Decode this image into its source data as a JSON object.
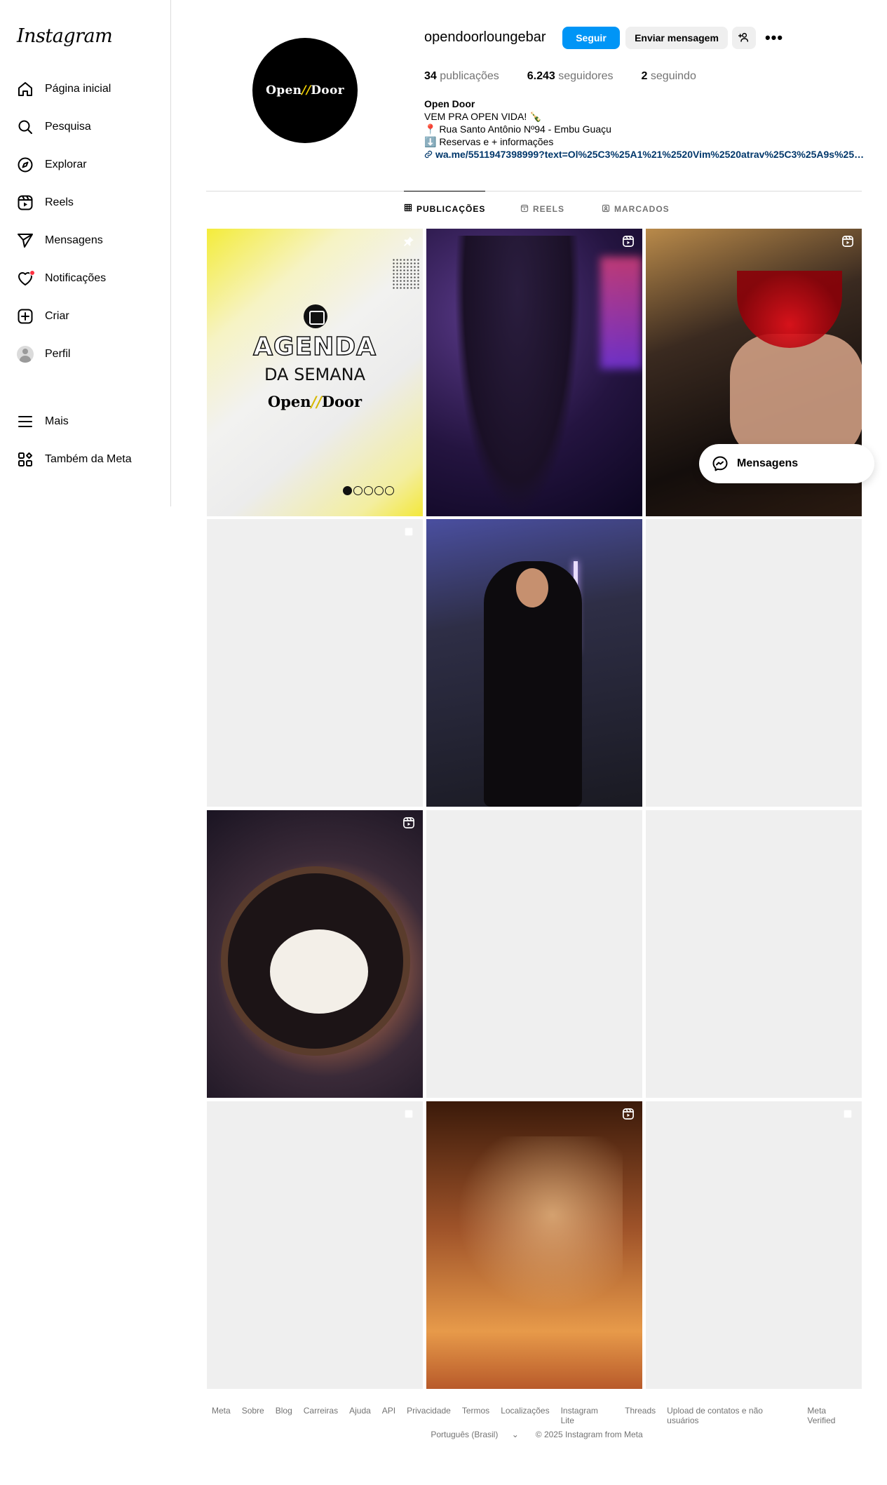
{
  "app": {
    "logo": "Instagram"
  },
  "sidebar": {
    "items": [
      {
        "label": "Página inicial",
        "icon": "home-icon"
      },
      {
        "label": "Pesquisa",
        "icon": "search-icon"
      },
      {
        "label": "Explorar",
        "icon": "compass-icon"
      },
      {
        "label": "Reels",
        "icon": "reels-icon"
      },
      {
        "label": "Mensagens",
        "icon": "send-icon"
      },
      {
        "label": "Notificações",
        "icon": "heart-icon"
      },
      {
        "label": "Criar",
        "icon": "plus-square-icon"
      },
      {
        "label": "Perfil",
        "icon": "avatar"
      },
      {
        "label": "Mais",
        "icon": "menu-icon"
      },
      {
        "label": "Também da Meta",
        "icon": "meta-apps-icon"
      }
    ]
  },
  "profile": {
    "username": "opendoorloungebar",
    "avatar_text": "Open Door",
    "follow_label": "Seguir",
    "message_label": "Enviar mensagem",
    "stats": {
      "posts_num": "34",
      "posts_label": "publicações",
      "followers_num": "6.243",
      "followers_label": "seguidores",
      "following_num": "2",
      "following_label": "seguindo"
    },
    "bio": {
      "name": "Open Door",
      "line1": "VEM PRA OPEN VIDA! 🍾",
      "line2": "📍 Rua Santo Antônio Nº94 - Embu Guaçu",
      "line3": "⬇️  Reservas e + informações",
      "link": "wa.me/5511947398999?text=Ol%25C3%25A1%21%2520Vim%2520atrav%25C3%25A9s%2520..."
    }
  },
  "tabs": [
    {
      "label": "PUBLICAÇÕES",
      "icon": "grid-icon"
    },
    {
      "label": "REELS",
      "icon": "reels-icon"
    },
    {
      "label": "MARCADOS",
      "icon": "tagged-icon"
    }
  ],
  "posts": {
    "agenda_title": "AGENDA",
    "agenda_sub": "DA SEMANA",
    "agenda_brand": "Open Door"
  },
  "floating_messages": {
    "label": "Mensagens"
  },
  "footer": {
    "links": [
      "Meta",
      "Sobre",
      "Blog",
      "Carreiras",
      "Ajuda",
      "API",
      "Privacidade",
      "Termos",
      "Localizações",
      "Instagram Lite",
      "Threads",
      "Upload de contatos e não usuários",
      "Meta Verified"
    ],
    "language": "Português (Brasil)",
    "copyright": "© 2025 Instagram from Meta"
  }
}
